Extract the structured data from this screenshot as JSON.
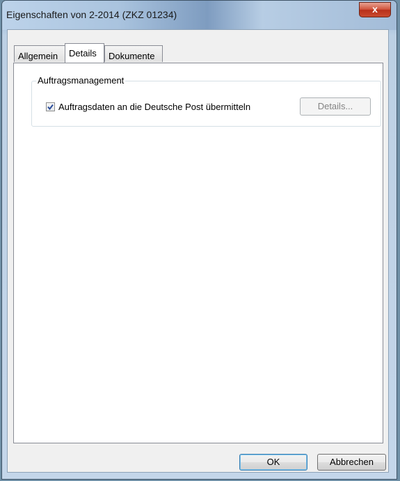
{
  "window": {
    "title": "Eigenschaften von 2-2014 (ZKZ 01234)",
    "close_label": "x"
  },
  "tabs": [
    {
      "label": "Allgemein",
      "active": false
    },
    {
      "label": "Details",
      "active": true
    },
    {
      "label": "Dokumente",
      "active": false
    }
  ],
  "group": {
    "legend": "Auftragsmanagement",
    "checkbox_label": "Auftragsdaten an die Deutsche Post übermitteln",
    "checkbox_checked": true,
    "details_button": "Details..."
  },
  "buttons": {
    "ok": "OK",
    "cancel": "Abbrechen"
  },
  "colors": {
    "accent": "#3c7fb1",
    "close": "#c9492e"
  }
}
